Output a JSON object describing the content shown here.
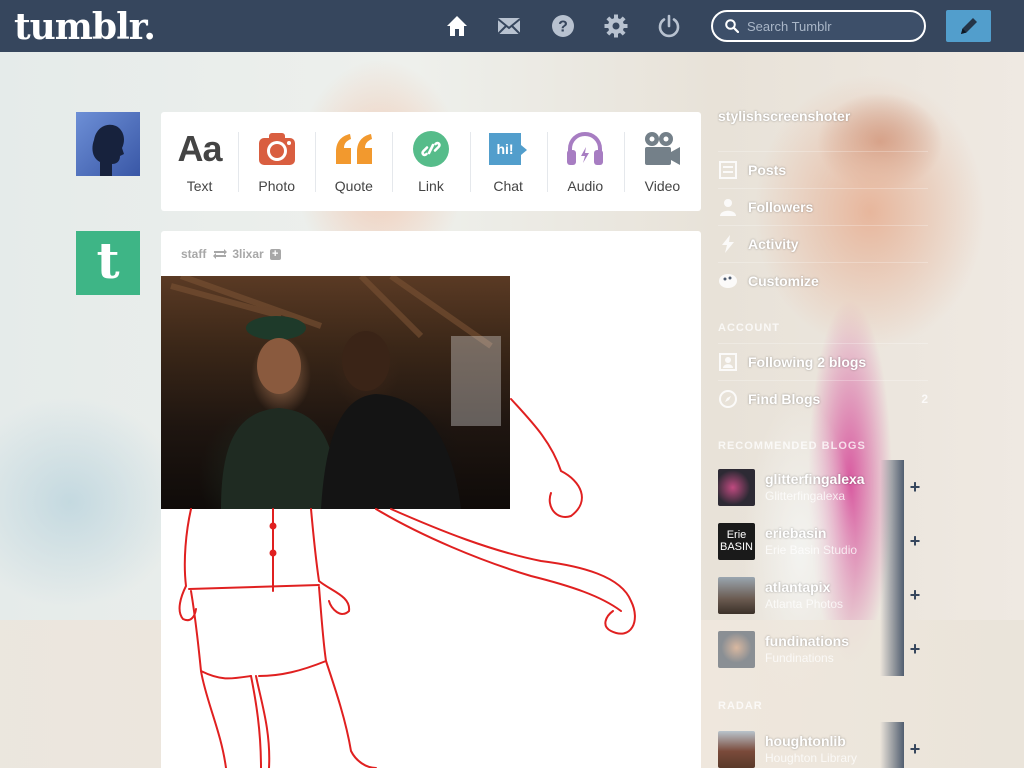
{
  "header": {
    "logo": "tumblr.",
    "search_placeholder": "Search Tumblr",
    "nav_icons": [
      "home-icon",
      "mail-icon",
      "help-icon",
      "gear-icon",
      "power-icon"
    ]
  },
  "post_types": [
    {
      "label": "Text",
      "glyph": "Aa",
      "color": "#444444"
    },
    {
      "label": "Photo",
      "color": "#d95e40"
    },
    {
      "label": "Quote",
      "color": "#f2992e"
    },
    {
      "label": "Link",
      "color": "#56bc8a"
    },
    {
      "label": "Chat",
      "color": "#529ecc",
      "glyph": "hi!"
    },
    {
      "label": "Audio",
      "color": "#a77dc2"
    },
    {
      "label": "Video",
      "color": "#748089"
    }
  ],
  "post": {
    "author": "staff",
    "reblogged_from": "3lixar"
  },
  "sidebar": {
    "blog_name": "stylishscreenshoter",
    "items": [
      {
        "label": "Posts",
        "count": ""
      },
      {
        "label": "Followers",
        "count": ""
      },
      {
        "label": "Activity",
        "count": ""
      },
      {
        "label": "Customize",
        "count": ""
      }
    ],
    "account_heading": "ACCOUNT",
    "account_items": [
      {
        "label": "Following 2 blogs",
        "count": ""
      },
      {
        "label": "Find Blogs",
        "count": "2"
      }
    ],
    "recommended_heading": "RECOMMENDED BLOGS",
    "recommended": [
      {
        "name": "glitterfingalexa",
        "sub": "Glitterfingalexa",
        "thumb": "#2d2a34"
      },
      {
        "name": "eriebasin",
        "sub": "Erie Basin Studio",
        "thumb": "#1a1a1a",
        "thumb_text": "Erie BASIN"
      },
      {
        "name": "atlantapix",
        "sub": "Atlanta Photos",
        "thumb": "#6a5a50"
      },
      {
        "name": "fundinations",
        "sub": "Fundinations",
        "thumb": "#8a8f94"
      }
    ],
    "radar_heading": "RADAR",
    "radar": {
      "name": "houghtonlib",
      "sub": "Houghton Library",
      "thumb": "#7a4a3a"
    }
  }
}
